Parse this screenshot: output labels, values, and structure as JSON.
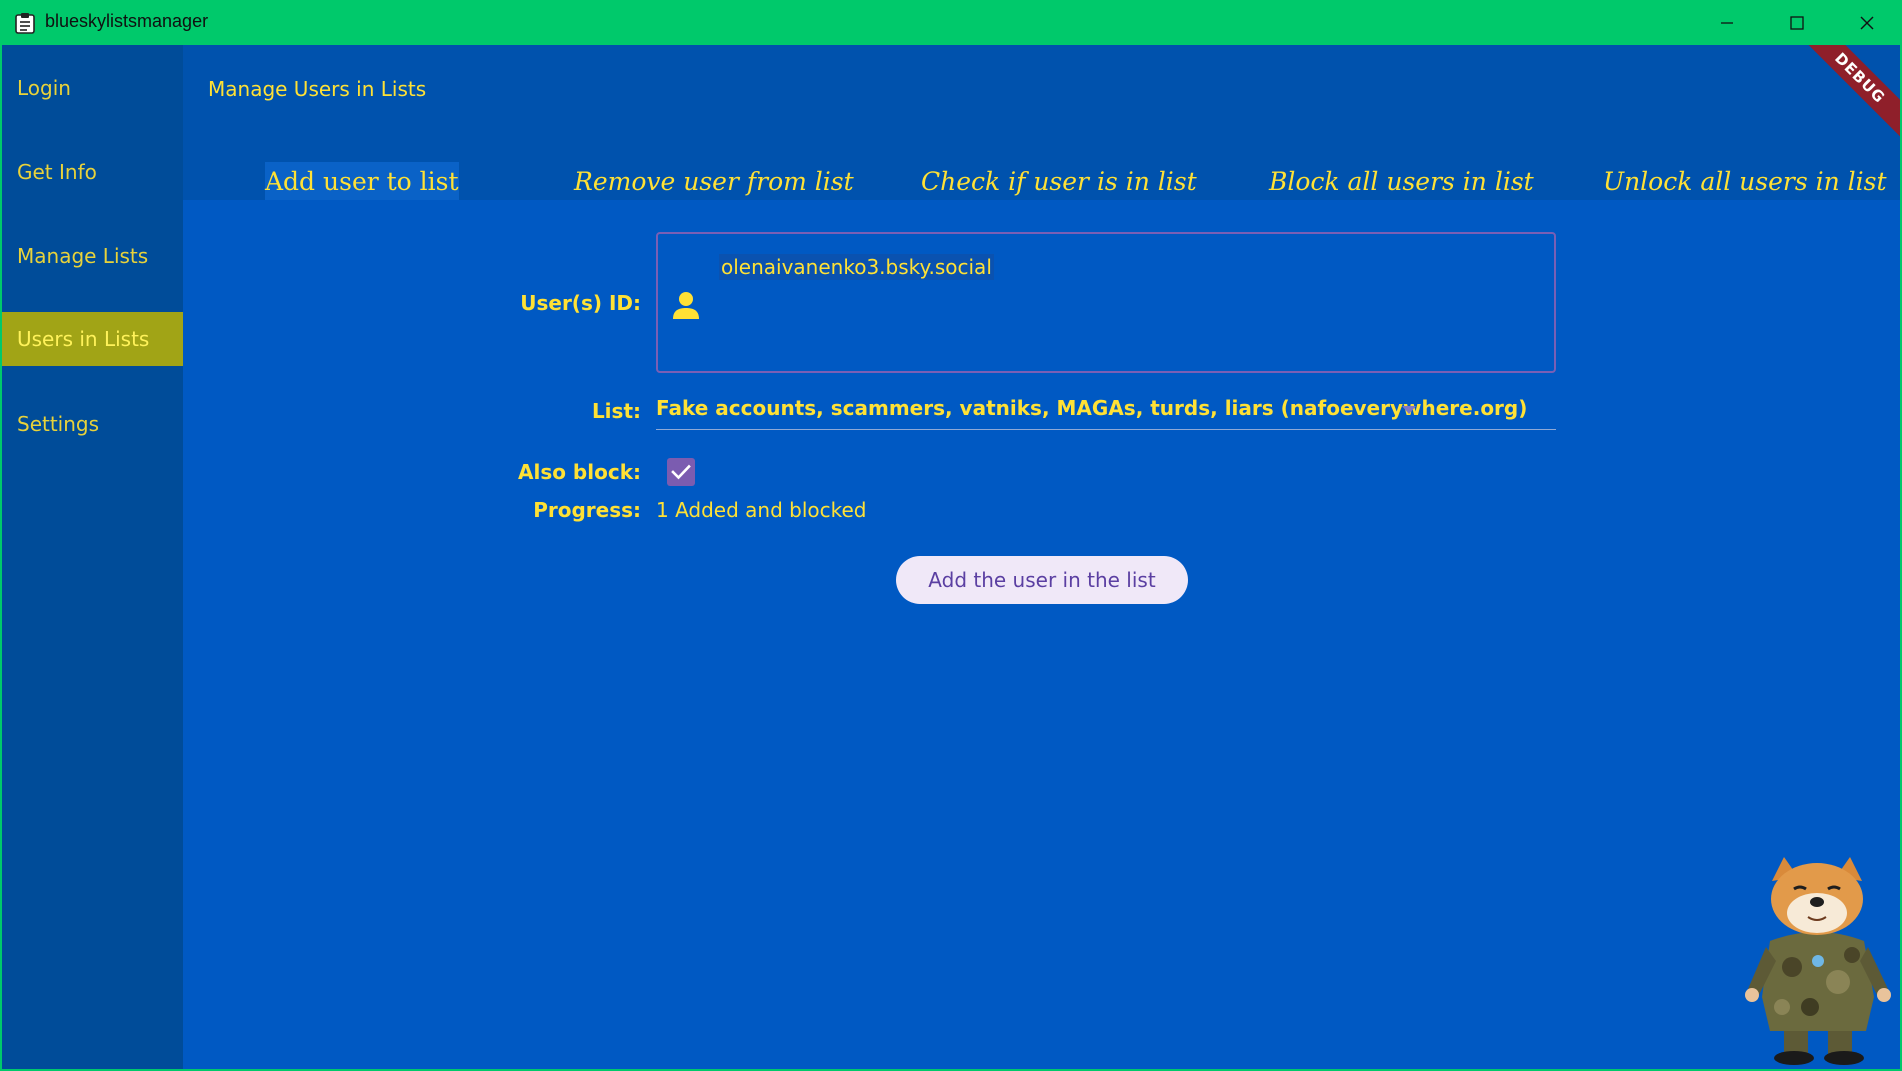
{
  "window": {
    "title": "blueskylistsmanager",
    "app_icon": "clipboard-icon",
    "controls": [
      "minimize-icon",
      "maximize-icon",
      "close-icon"
    ]
  },
  "sidebar": {
    "items": [
      {
        "label": "Login"
      },
      {
        "label": "Get Info"
      },
      {
        "label": "Manage Lists"
      },
      {
        "label": "Users in Lists",
        "active": true
      },
      {
        "label": "Settings"
      }
    ]
  },
  "header": {
    "title": "Manage Users in Lists",
    "debug_banner": "DEBUG"
  },
  "tabs": [
    {
      "label": "Add user to list",
      "active": true
    },
    {
      "label": "Remove user from list"
    },
    {
      "label": "Check if user is in list"
    },
    {
      "label": "Block all users in list"
    },
    {
      "label": "Unlock all users in list"
    }
  ],
  "form": {
    "user_ids_label": "User(s) ID:",
    "user_ids_value": "olenaivanenko3.bsky.social",
    "list_label": "List:",
    "list_value": "Fake accounts, scammers, vatniks, MAGAs, turds, liars (nafoeverywhere.org)",
    "also_block_label": "Also block:",
    "also_block_checked": true,
    "progress_label": "Progress:",
    "progress_value": "1 Added and blocked",
    "submit_label": "Add the user in the list"
  },
  "colors": {
    "titlebar": "#00c96b",
    "background": "#0059c3",
    "sidebar": "#004c99",
    "accent_text": "#ffe135",
    "active_nav": "#a1a416",
    "button_bg": "#f0e8f8",
    "button_text": "#5b3fa2"
  }
}
